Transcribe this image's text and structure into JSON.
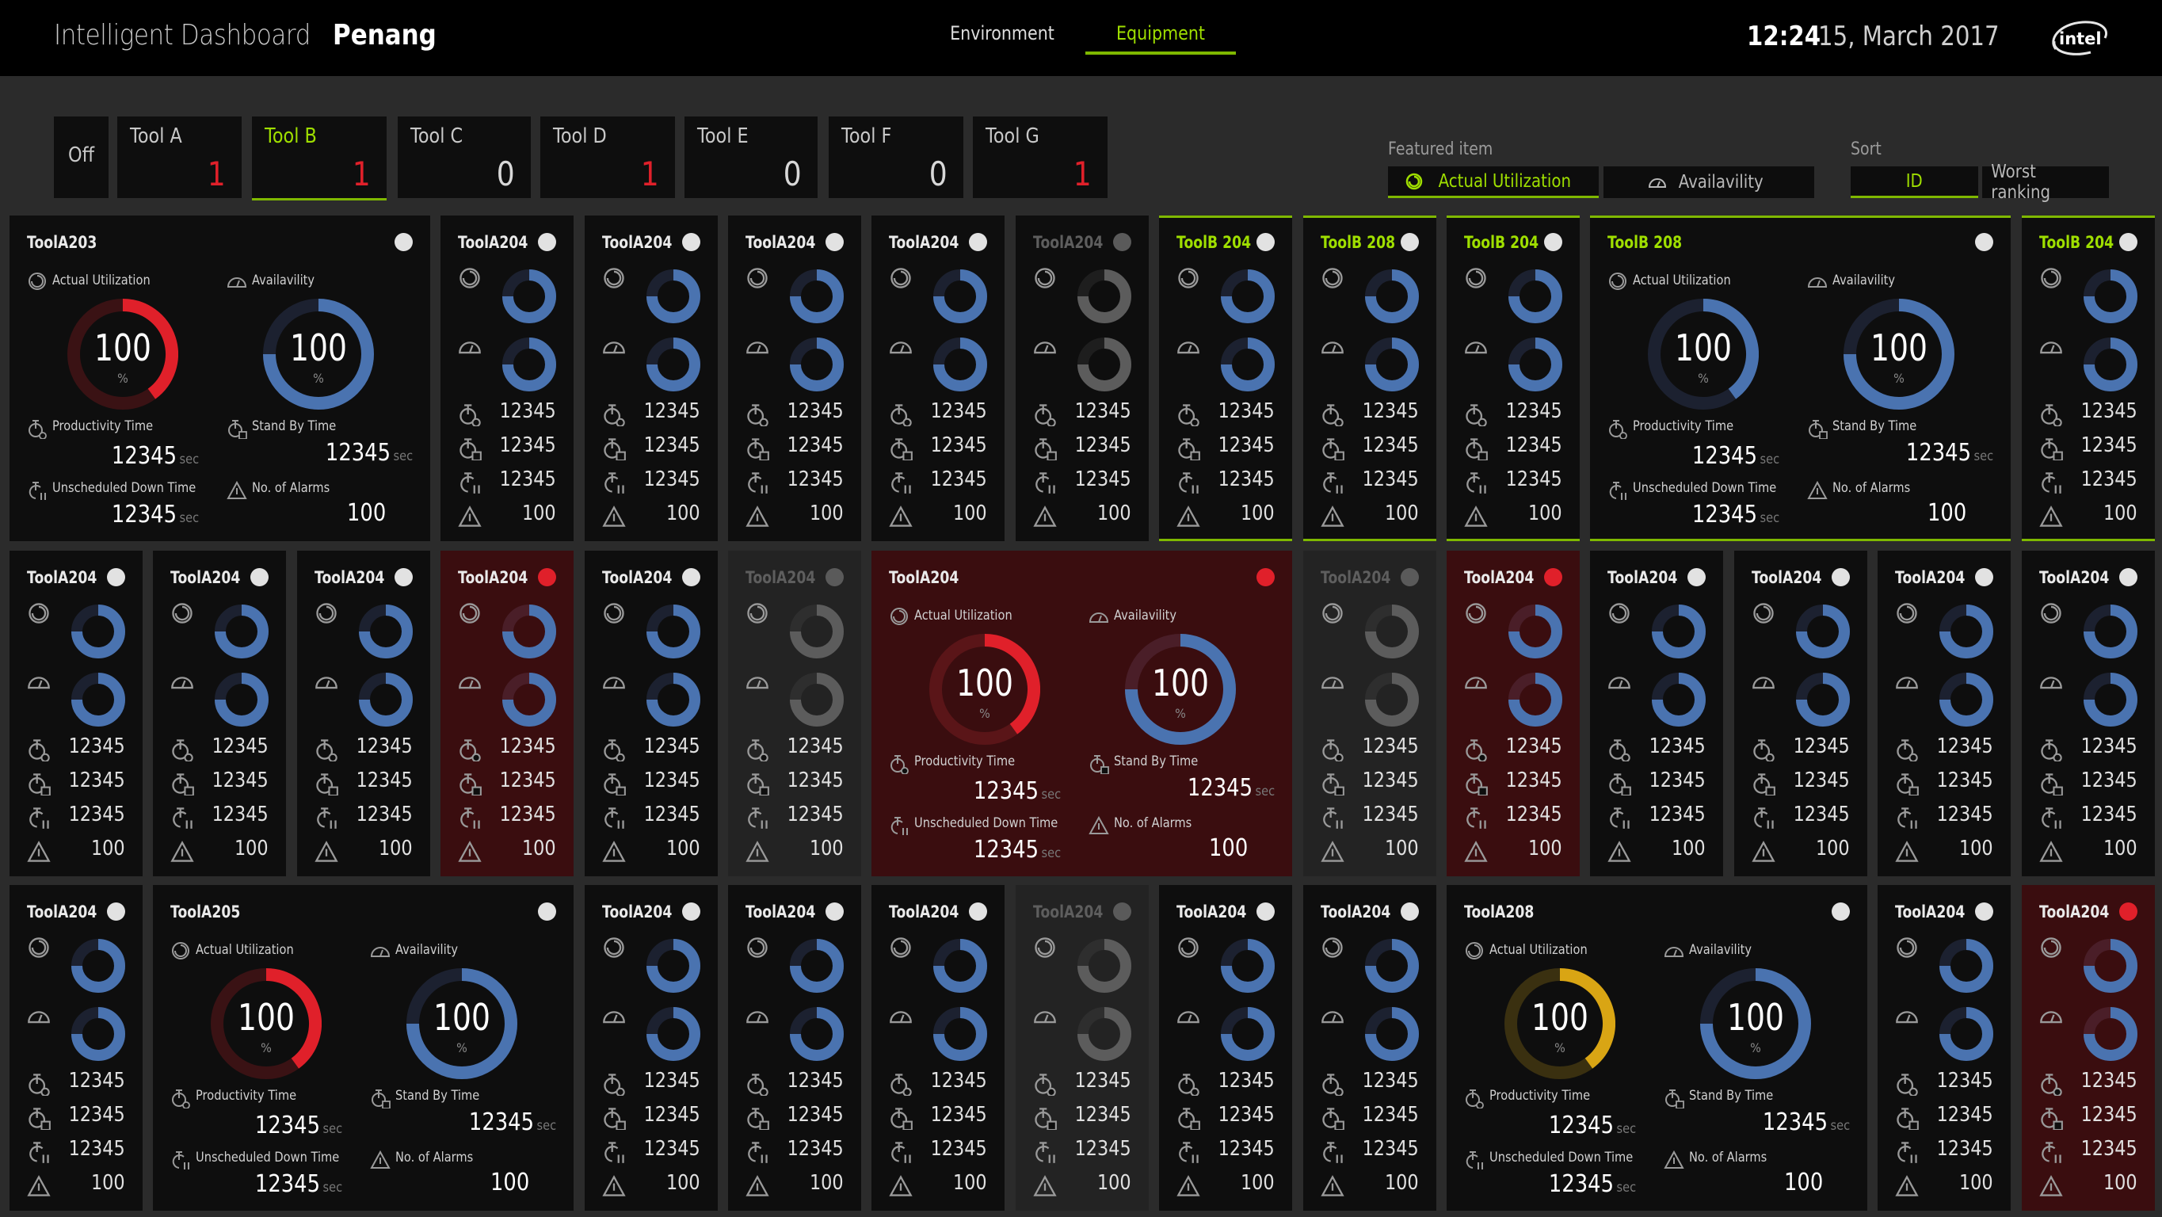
{
  "header": {
    "app_title": "Intelligent Dashboard",
    "site": "Penang",
    "nav": [
      {
        "label": "Environment",
        "active": false
      },
      {
        "label": "Equipment",
        "active": true
      }
    ],
    "time": "12:24",
    "date": "15, March 2017",
    "logo": "intel"
  },
  "tool_tabs": [
    {
      "label": "Off",
      "count": null,
      "active": false,
      "off": true
    },
    {
      "label": "Tool A",
      "count": "1",
      "alert": true,
      "active": false
    },
    {
      "label": "Tool B",
      "count": "1",
      "alert": true,
      "active": true
    },
    {
      "label": "Tool C",
      "count": "0",
      "alert": false,
      "active": false
    },
    {
      "label": "Tool D",
      "count": "1",
      "alert": true,
      "active": false
    },
    {
      "label": "Tool E",
      "count": "0",
      "alert": false,
      "active": false
    },
    {
      "label": "Tool F",
      "count": "0",
      "alert": false,
      "active": false
    },
    {
      "label": "Tool G",
      "count": "1",
      "alert": true,
      "active": false
    }
  ],
  "featured_item": {
    "label": "Featured item",
    "options": [
      {
        "label": "Actual Utilization",
        "icon": "utilization-icon",
        "active": true
      },
      {
        "label": "Availavility",
        "icon": "gauge-icon",
        "active": false
      }
    ]
  },
  "sort": {
    "label": "Sort",
    "options": [
      {
        "label": "ID",
        "active": true
      },
      {
        "label": "Worst ranking",
        "active": false
      }
    ]
  },
  "labels": {
    "actual_utilization": "Actual Utilization",
    "availability": "Availavility",
    "productivity_time": "Productivity Time",
    "stand_by_time": "Stand By Time",
    "unscheduled_down_time": "Unscheduled Down Time",
    "no_of_alarms": "No. of Alarms",
    "sec": "sec",
    "percent": "%"
  },
  "colors": {
    "accent_green": "#9fdf00",
    "alarm_red": "#e0202a",
    "ok_blue": "#4a73b0",
    "warn_yellow": "#d9a514",
    "off_gray": "#5a5a5a",
    "alarm_bg": "#3a0d0f"
  },
  "rows": [
    [
      {
        "name": "ToolA203",
        "size": "large",
        "state": "normal",
        "status": "white",
        "util_color": "red",
        "util": 100,
        "util_fill": 0.4,
        "avail": 100,
        "avail_fill": 0.75,
        "productivity": "12345",
        "standby": "12345",
        "downtime": "12345",
        "alarms": "100"
      },
      {
        "name": "ToolA204",
        "size": "small",
        "state": "normal",
        "status": "white",
        "util_fill": 0.75,
        "avail_fill": 0.75,
        "productivity": "12345",
        "standby": "12345",
        "downtime": "12345",
        "alarms": "100"
      },
      {
        "name": "ToolA204",
        "size": "small",
        "state": "normal",
        "status": "white",
        "util_fill": 0.75,
        "avail_fill": 0.75,
        "productivity": "12345",
        "standby": "12345",
        "downtime": "12345",
        "alarms": "100"
      },
      {
        "name": "ToolA204",
        "size": "small",
        "state": "normal",
        "status": "white",
        "util_fill": 0.75,
        "avail_fill": 0.75,
        "productivity": "12345",
        "standby": "12345",
        "downtime": "12345",
        "alarms": "100"
      },
      {
        "name": "ToolA204",
        "size": "small",
        "state": "normal",
        "status": "white",
        "util_fill": 0.75,
        "avail_fill": 0.75,
        "productivity": "12345",
        "standby": "12345",
        "downtime": "12345",
        "alarms": "100"
      },
      {
        "name": "ToolA204",
        "size": "small",
        "state": "off-dim",
        "status": "gray",
        "util_fill": 0.75,
        "avail_fill": 0.75,
        "productivity": "12345",
        "standby": "12345",
        "downtime": "12345",
        "alarms": "100"
      },
      {
        "name": "ToolB 204",
        "size": "small",
        "state": "featured",
        "status": "white",
        "util_fill": 0.75,
        "avail_fill": 0.75,
        "productivity": "12345",
        "standby": "12345",
        "downtime": "12345",
        "alarms": "100"
      },
      {
        "name": "ToolB 208",
        "size": "small",
        "state": "featured",
        "status": "white",
        "util_fill": 0.75,
        "avail_fill": 0.75,
        "productivity": "12345",
        "standby": "12345",
        "downtime": "12345",
        "alarms": "100"
      },
      {
        "name": "ToolB 204",
        "size": "small",
        "state": "featured",
        "status": "white",
        "util_fill": 0.75,
        "avail_fill": 0.75,
        "productivity": "12345",
        "standby": "12345",
        "downtime": "12345",
        "alarms": "100"
      },
      {
        "name": "ToolB 208",
        "size": "large",
        "state": "featured",
        "status": "white",
        "util_color": "blue",
        "util": 100,
        "util_fill": 0.4,
        "avail": 100,
        "avail_fill": 0.75,
        "productivity": "12345",
        "standby": "12345",
        "downtime": "12345",
        "alarms": "100"
      },
      {
        "name": "ToolB 204",
        "size": "small",
        "state": "featured",
        "status": "white",
        "util_fill": 0.75,
        "avail_fill": 0.75,
        "productivity": "12345",
        "standby": "12345",
        "downtime": "12345",
        "alarms": "100"
      }
    ],
    [
      {
        "name": "ToolA204",
        "size": "small",
        "state": "normal",
        "status": "white",
        "util_fill": 0.75,
        "avail_fill": 0.75,
        "productivity": "12345",
        "standby": "12345",
        "downtime": "12345",
        "alarms": "100"
      },
      {
        "name": "ToolA204",
        "size": "small",
        "state": "normal",
        "status": "white",
        "util_fill": 0.75,
        "avail_fill": 0.75,
        "productivity": "12345",
        "standby": "12345",
        "downtime": "12345",
        "alarms": "100"
      },
      {
        "name": "ToolA204",
        "size": "small",
        "state": "normal",
        "status": "white",
        "util_fill": 0.75,
        "avail_fill": 0.75,
        "productivity": "12345",
        "standby": "12345",
        "downtime": "12345",
        "alarms": "100"
      },
      {
        "name": "ToolA204",
        "size": "small",
        "state": "alarm",
        "status": "red",
        "util_fill": 0.75,
        "avail_fill": 0.75,
        "productivity": "12345",
        "standby": "12345",
        "downtime": "12345",
        "alarms": "100"
      },
      {
        "name": "ToolA204",
        "size": "small",
        "state": "normal",
        "status": "white",
        "util_fill": 0.75,
        "avail_fill": 0.75,
        "productivity": "12345",
        "standby": "12345",
        "downtime": "12345",
        "alarms": "100"
      },
      {
        "name": "ToolA204",
        "size": "small",
        "state": "off-gray",
        "status": "gray",
        "util_fill": 0.75,
        "avail_fill": 0.75,
        "productivity": "12345",
        "standby": "12345",
        "downtime": "12345",
        "alarms": "100"
      },
      {
        "name": "ToolA204",
        "size": "large",
        "state": "alarm",
        "status": "red",
        "util_color": "red",
        "util": 100,
        "util_fill": 0.4,
        "avail": 100,
        "avail_fill": 0.75,
        "productivity": "12345",
        "standby": "12345",
        "downtime": "12345",
        "alarms": "100"
      },
      {
        "name": "ToolA204",
        "size": "small",
        "state": "off-gray",
        "status": "gray",
        "util_fill": 0.75,
        "avail_fill": 0.75,
        "productivity": "12345",
        "standby": "12345",
        "downtime": "12345",
        "alarms": "100"
      },
      {
        "name": "ToolA204",
        "size": "small",
        "state": "alarm",
        "status": "red",
        "util_fill": 0.75,
        "avail_fill": 0.75,
        "productivity": "12345",
        "standby": "12345",
        "downtime": "12345",
        "alarms": "100"
      },
      {
        "name": "ToolA204",
        "size": "small",
        "state": "normal",
        "status": "white",
        "util_fill": 0.75,
        "avail_fill": 0.75,
        "productivity": "12345",
        "standby": "12345",
        "downtime": "12345",
        "alarms": "100"
      },
      {
        "name": "ToolA204",
        "size": "small",
        "state": "normal",
        "status": "white",
        "util_fill": 0.75,
        "avail_fill": 0.75,
        "productivity": "12345",
        "standby": "12345",
        "downtime": "12345",
        "alarms": "100"
      },
      {
        "name": "ToolA204",
        "size": "small",
        "state": "normal",
        "status": "white",
        "util_fill": 0.75,
        "avail_fill": 0.75,
        "productivity": "12345",
        "standby": "12345",
        "downtime": "12345",
        "alarms": "100"
      },
      {
        "name": "ToolA204",
        "size": "small",
        "state": "normal",
        "status": "white",
        "util_fill": 0.75,
        "avail_fill": 0.75,
        "productivity": "12345",
        "standby": "12345",
        "downtime": "12345",
        "alarms": "100"
      }
    ],
    [
      {
        "name": "ToolA204",
        "size": "small",
        "state": "normal",
        "status": "white",
        "util_fill": 0.75,
        "avail_fill": 0.75,
        "productivity": "12345",
        "standby": "12345",
        "downtime": "12345",
        "alarms": "100"
      },
      {
        "name": "ToolA205",
        "size": "large",
        "state": "normal",
        "status": "white",
        "util_color": "red",
        "util": 100,
        "util_fill": 0.4,
        "avail": 100,
        "avail_fill": 0.75,
        "productivity": "12345",
        "standby": "12345",
        "downtime": "12345",
        "alarms": "100"
      },
      {
        "name": "ToolA204",
        "size": "small",
        "state": "normal",
        "status": "white",
        "util_fill": 0.75,
        "avail_fill": 0.75,
        "productivity": "12345",
        "standby": "12345",
        "downtime": "12345",
        "alarms": "100"
      },
      {
        "name": "ToolA204",
        "size": "small",
        "state": "normal",
        "status": "white",
        "util_fill": 0.75,
        "avail_fill": 0.75,
        "productivity": "12345",
        "standby": "12345",
        "downtime": "12345",
        "alarms": "100"
      },
      {
        "name": "ToolA204",
        "size": "small",
        "state": "normal",
        "status": "white",
        "util_fill": 0.75,
        "avail_fill": 0.75,
        "productivity": "12345",
        "standby": "12345",
        "downtime": "12345",
        "alarms": "100"
      },
      {
        "name": "ToolA204",
        "size": "small",
        "state": "off-gray",
        "status": "gray",
        "util_fill": 0.75,
        "avail_fill": 0.75,
        "productivity": "12345",
        "standby": "12345",
        "downtime": "12345",
        "alarms": "100"
      },
      {
        "name": "ToolA204",
        "size": "small",
        "state": "normal",
        "status": "white",
        "util_fill": 0.75,
        "avail_fill": 0.75,
        "productivity": "12345",
        "standby": "12345",
        "downtime": "12345",
        "alarms": "100"
      },
      {
        "name": "ToolA204",
        "size": "small",
        "state": "normal",
        "status": "white",
        "util_fill": 0.75,
        "avail_fill": 0.75,
        "productivity": "12345",
        "standby": "12345",
        "downtime": "12345",
        "alarms": "100"
      },
      {
        "name": "ToolA208",
        "size": "large",
        "state": "normal",
        "status": "white",
        "util_color": "yellow",
        "util": 100,
        "util_fill": 0.4,
        "avail": 100,
        "avail_fill": 0.75,
        "productivity": "12345",
        "standby": "12345",
        "downtime": "12345",
        "alarms": "100"
      },
      {
        "name": "ToolA204",
        "size": "small",
        "state": "normal",
        "status": "white",
        "util_fill": 0.75,
        "avail_fill": 0.75,
        "productivity": "12345",
        "standby": "12345",
        "downtime": "12345",
        "alarms": "100"
      },
      {
        "name": "ToolA204",
        "size": "small",
        "state": "alarm",
        "status": "red",
        "util_fill": 0.75,
        "avail_fill": 0.75,
        "productivity": "12345",
        "standby": "12345",
        "downtime": "12345",
        "alarms": "100"
      }
    ]
  ]
}
